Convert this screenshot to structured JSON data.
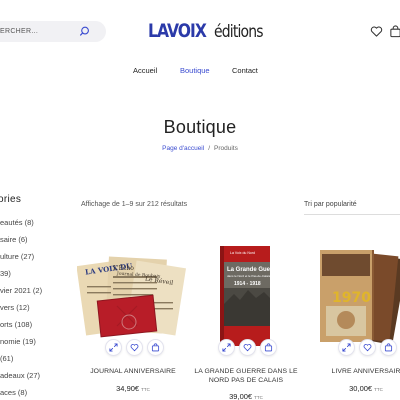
{
  "header": {
    "search": {
      "placeholder": "ERCHER..."
    },
    "logo": {
      "brand": "LAVOIX",
      "sub": "éditions"
    }
  },
  "nav": {
    "items": [
      {
        "label": "Accueil"
      },
      {
        "label": "Boutique"
      },
      {
        "label": "Contact"
      }
    ],
    "active": "Boutique"
  },
  "page": {
    "title": "Boutique",
    "breadcrumb": {
      "home": "Page d'accueil",
      "separator": "/",
      "current": "Produits"
    }
  },
  "sidebar": {
    "title": "ories",
    "categories": [
      {
        "label": "eautés (8)"
      },
      {
        "label": "saire (6)"
      },
      {
        "label": "ulture (27)"
      },
      {
        "label": "39)"
      },
      {
        "label": "vier 2021 (2)"
      },
      {
        "label": "vers (12)"
      },
      {
        "label": "orts (108)"
      },
      {
        "label": "nomie (19)"
      },
      {
        "label": "(61)"
      },
      {
        "label": "adeaux (27)"
      },
      {
        "label": "aces (8)"
      }
    ]
  },
  "toolbar": {
    "result_count": "Affichage de 1–9 sur 212 résultats",
    "sort": "Tri par popularité"
  },
  "products": [
    {
      "name_line1": "JOURNAL ANNIVERSAIRE",
      "name_line2": "",
      "price": "34,90€",
      "ttc": "TTC"
    },
    {
      "name_line1": "LA GRANDE GUERRE DANS LE",
      "name_line2": "NORD PAS DE CALAIS",
      "price": "39,00€",
      "ttc": "TTC"
    },
    {
      "name_line1": "LIVRE ANNIVERSAIR",
      "name_line2": "",
      "price": "30,00€",
      "ttc": "TTC"
    }
  ],
  "product_images": {
    "book2": {
      "top_label": "La Voix du Nord",
      "title": "La Grande Guerre",
      "subtitle": "dans le Nord et le Pas-de-Calais",
      "years": "1914 - 1918"
    },
    "book3": {
      "year": "1970"
    },
    "newspaper": {
      "mast1": "L'Écho",
      "mast2": "Journal de Roubaix",
      "mast3": "Le Réveil",
      "mast4": "LA VOIX DU"
    }
  },
  "colors": {
    "accent": "#3a4bd0",
    "brand": "#2b3aa9"
  },
  "icons": [
    "search-icon",
    "heart-icon",
    "shopping-bag-icon",
    "expand-icon"
  ]
}
